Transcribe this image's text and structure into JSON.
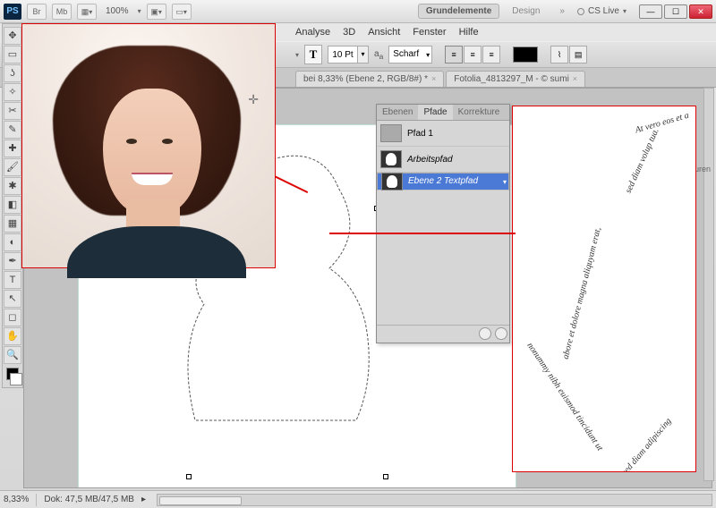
{
  "titlebar": {
    "logo": "PS",
    "btn_br": "Br",
    "btn_mb": "Mb",
    "zoom": "100%",
    "workspace_active": "Grundelemente",
    "workspace_2": "Design",
    "cslive": "CS Live"
  },
  "menu": {
    "analyse": "Analyse",
    "dreid": "3D",
    "ansicht": "Ansicht",
    "fenster": "Fenster",
    "hilfe": "Hilfe"
  },
  "options": {
    "font_size": "10 Pt",
    "aa_label": "Scharf"
  },
  "tabs": {
    "t1": "bei 8,33% (Ebene 2, RGB/8#) *",
    "t2": "Fotolia_4813297_M - © sumi"
  },
  "panel": {
    "tab_ebenen": "Ebenen",
    "tab_pfade": "Pfade",
    "tab_korrekturen": "Korrekture",
    "row1": "Pfad 1",
    "row2": "Arbeitspfad",
    "row3": "Ebene 2 Textpfad"
  },
  "right_tab": "uren",
  "status": {
    "zoom": "8,33%",
    "dok": "Dok: 47,5 MB/47,5 MB"
  },
  "textpath": {
    "s1": "At vero eos et a",
    "s2": "sed diam volup tua.",
    "s3": "abore et dolore magna aliquyam erat,",
    "s4": "nonummy nibh euismod tincidunt ut",
    "s5": "sed diam adipiscing"
  }
}
